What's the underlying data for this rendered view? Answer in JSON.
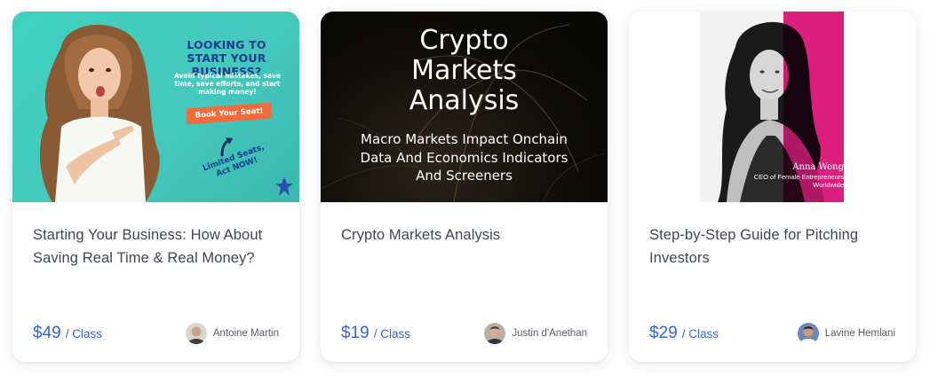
{
  "cards": [
    {
      "thumb": {
        "headline": "LOOKING TO START YOUR BUSINESS?",
        "sub": "Avoid typical mistakes, save time, save efforts, and start making money!",
        "cta": "Book Your Seat!",
        "note": "Limited Seats, Act NOW!"
      },
      "title": "Starting Your Business: How About Saving Real Time & Real Money?",
      "price": "$49",
      "per": "/ Class",
      "author": "Antoine Martin"
    },
    {
      "thumb": {
        "headline": "Crypto Markets Analysis",
        "sub": "Macro Markets Impact Onchain Data And Economics Indicators And Screeners"
      },
      "title": "Crypto Markets Analysis",
      "price": "$19",
      "per": "/ Class",
      "author": "Justin d'Anethan"
    },
    {
      "thumb": {
        "caption_name": "Anna Wong",
        "caption_role": "CEO of Female Entrepreneurs Worldwide"
      },
      "title": "Step-by-Step Guide for Pitching Investors",
      "price": "$29",
      "per": "/ Class",
      "author": "Lavine Hemlani"
    }
  ],
  "colors": {
    "price": "#3565d8",
    "title": "#3e4654",
    "teal": "#3fd2c0",
    "pink": "#e8147f",
    "cta_orange": "#f36b3c",
    "headline_navy": "#1a3b8f"
  }
}
